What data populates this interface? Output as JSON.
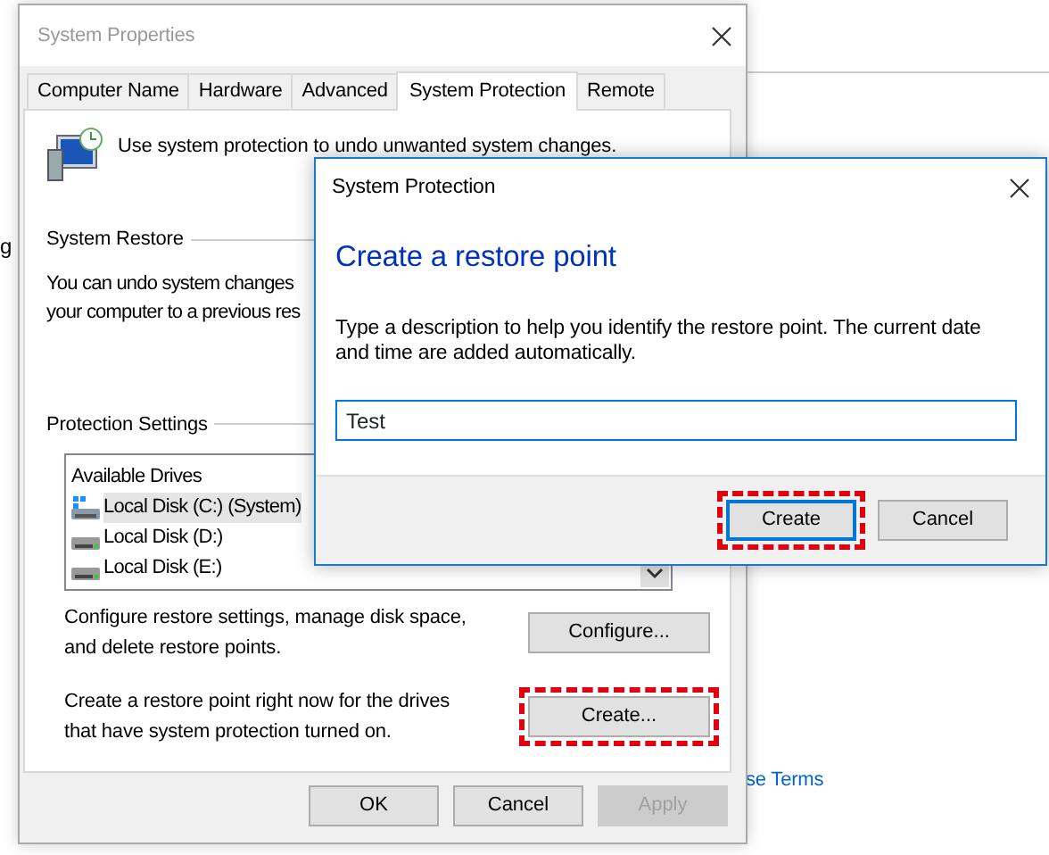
{
  "background": {
    "edge_text": "g",
    "link": "se Terms"
  },
  "window": {
    "title": "System Properties"
  },
  "tabs": [
    {
      "label": "Computer Name",
      "selected": false
    },
    {
      "label": "Hardware",
      "selected": false
    },
    {
      "label": "Advanced",
      "selected": false
    },
    {
      "label": "System Protection",
      "selected": true
    },
    {
      "label": "Remote",
      "selected": false
    }
  ],
  "intro": "Use system protection to undo unwanted system changes.",
  "system_restore": {
    "label": "System Restore",
    "lines": [
      "You can undo system changes",
      "your computer to a previous res"
    ]
  },
  "protection_settings": {
    "label": "Protection Settings",
    "list_header": "Available Drives",
    "drives": [
      {
        "name": "Local Disk (C:) (System)",
        "kind": "system",
        "selected": true
      },
      {
        "name": "Local Disk (D:)",
        "kind": "disk",
        "selected": false
      },
      {
        "name": "Local Disk (E:)",
        "kind": "disk",
        "selected": false
      }
    ]
  },
  "configure": {
    "text": "Configure restore settings, manage disk space, and delete restore points.",
    "button": "Configure...",
    "highlighted": false
  },
  "create": {
    "text": "Create a restore point right now for the drives that have system protection turned on.",
    "button": "Create...",
    "highlighted": true
  },
  "buttons": [
    {
      "label": "OK",
      "disabled": false
    },
    {
      "label": "Cancel",
      "disabled": false
    },
    {
      "label": "Apply",
      "disabled": true
    }
  ],
  "dialog": {
    "title": "System Protection",
    "heading": "Create a restore point",
    "description": "Type a description to help you identify the restore point. The current date and time are added automatically.",
    "input": {
      "value": "Test"
    },
    "buttons": [
      {
        "label": "Create",
        "default": true,
        "highlighted": true
      },
      {
        "label": "Cancel",
        "default": false,
        "highlighted": false
      }
    ]
  }
}
